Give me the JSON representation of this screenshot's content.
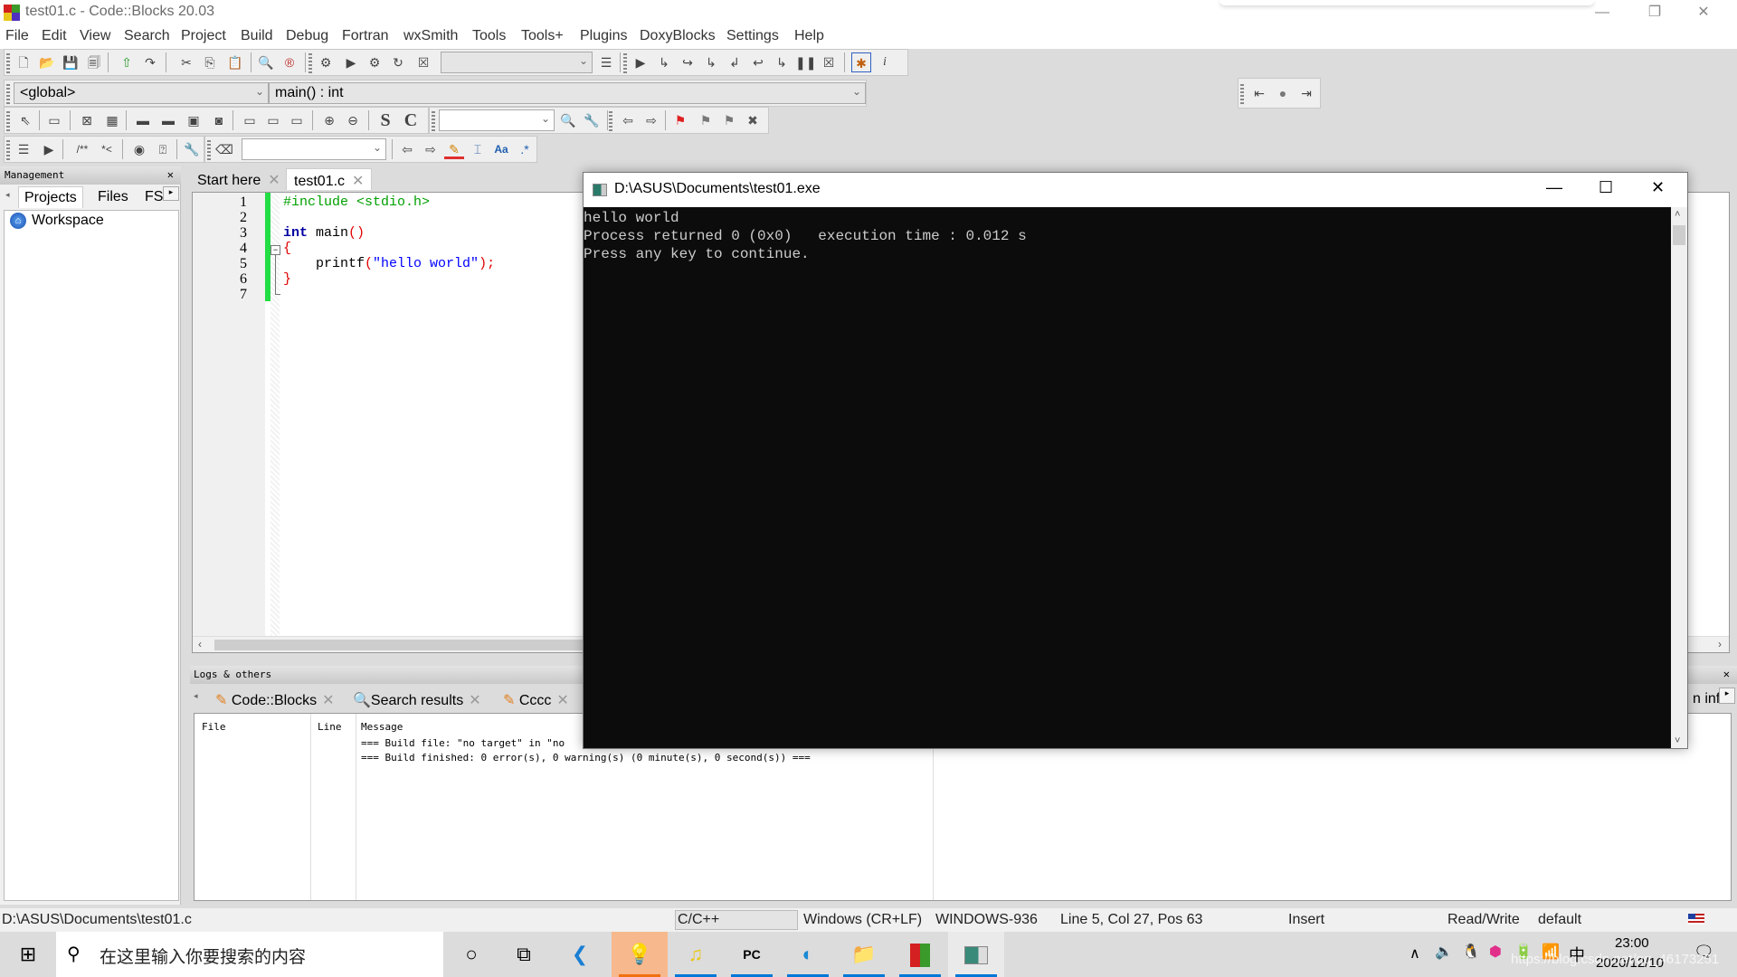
{
  "window": {
    "title": "test01.c - Code::Blocks 20.03",
    "controls": {
      "minimize": "—",
      "restore": "❐",
      "close": "✕"
    }
  },
  "menu": [
    {
      "label": "File",
      "u": "F",
      "rest": "ile"
    },
    {
      "label": "Edit",
      "u": "E",
      "rest": "dit"
    },
    {
      "label": "View",
      "u": "V",
      "rest": "iew"
    },
    {
      "label": "Search",
      "pre": "Sea",
      "u": "r",
      "rest": "ch"
    },
    {
      "label": "Project",
      "u": "P",
      "rest": "roject"
    },
    {
      "label": "Build",
      "u": "B",
      "rest": "uild"
    },
    {
      "label": "Debug",
      "u": "D",
      "rest": "ebug"
    },
    {
      "label": "Fortran"
    },
    {
      "label": "wxSmith"
    },
    {
      "label": "Tools"
    },
    {
      "label": "Tools+"
    },
    {
      "label": "Plugins"
    },
    {
      "label": "DoxyBlocks"
    },
    {
      "label": "Settings"
    },
    {
      "label": "Help"
    }
  ],
  "toolbar": {
    "scope_combo": "<global>",
    "function_combo": "main() : int",
    "build_target_combo": "",
    "find_combo": "",
    "search_combo": ""
  },
  "management": {
    "title": "Management",
    "tabs": [
      "Projects",
      "Files",
      "FS"
    ],
    "tree": [
      {
        "label": "Workspace",
        "icon": "workspace-icon"
      }
    ]
  },
  "editor": {
    "tabs": [
      {
        "label": "Start here",
        "active": false
      },
      {
        "label": "test01.c",
        "active": true
      }
    ],
    "lines": [
      {
        "n": "1",
        "parts": [
          {
            "t": "#include <stdio.h>",
            "c": "#00a000"
          }
        ]
      },
      {
        "n": "2",
        "parts": []
      },
      {
        "n": "3",
        "parts": [
          {
            "t": "int",
            "c": "#0000a0",
            "b": true
          },
          {
            "t": " main",
            "c": "#000"
          },
          {
            "t": "()",
            "c": "#e00000"
          }
        ]
      },
      {
        "n": "4",
        "parts": [
          {
            "t": "{",
            "c": "#e00000"
          }
        ]
      },
      {
        "n": "5",
        "parts": [
          {
            "t": "    printf",
            "c": "#000"
          },
          {
            "t": "(",
            "c": "#e00000"
          },
          {
            "t": "\"hello world\"",
            "c": "#0000ff"
          },
          {
            "t": ");",
            "c": "#e00000"
          }
        ]
      },
      {
        "n": "6",
        "parts": [
          {
            "t": "}",
            "c": "#e00000"
          }
        ]
      },
      {
        "n": "7",
        "parts": []
      }
    ]
  },
  "logs": {
    "title": "Logs & others",
    "tabs": [
      {
        "label": "Code::Blocks",
        "icon": "pencil-icon"
      },
      {
        "label": "Search results",
        "icon": "search-icon"
      },
      {
        "label": "Cccc",
        "icon": "pencil-icon"
      }
    ],
    "partial_tab": "n info",
    "columns": [
      "File",
      "Line",
      "Message"
    ],
    "rows": [
      {
        "file": "",
        "line": "",
        "message": "=== Build file: \"no target\" in \"no"
      },
      {
        "file": "",
        "line": "",
        "message": "=== Build finished: 0 error(s), 0 warning(s) (0 minute(s), 0 second(s)) ==="
      }
    ]
  },
  "console": {
    "title": "D:\\ASUS\\Documents\\test01.exe",
    "output": "hello world\nProcess returned 0 (0x0)   execution time : 0.012 s\nPress any key to continue."
  },
  "statusbar": {
    "path": "D:\\ASUS\\Documents\\test01.c",
    "language": "C/C++",
    "eol": "Windows (CR+LF)",
    "encoding": "WINDOWS-936",
    "position": "Line 5, Col 27, Pos 63",
    "mode": "Insert",
    "access": "Read/Write",
    "profile": "default"
  },
  "taskbar": {
    "search_placeholder": "在这里输入你要搜索的内容",
    "time": "23:00",
    "date": "2020/12/10",
    "ime": "中",
    "watermark": "https://blog.csdn.net/qq_46173251"
  }
}
